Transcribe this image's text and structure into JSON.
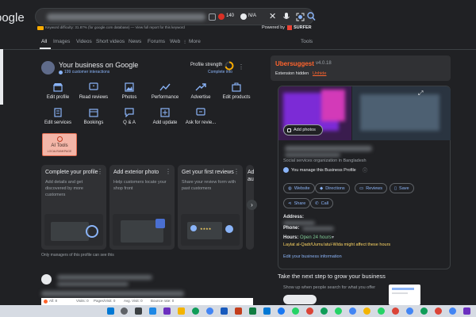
{
  "header": {
    "logo": "oogle",
    "search_right": {
      "score": "140",
      "na": "N/A"
    },
    "keyword_line": "Keyword difficulty: 31.87% (for google.com database) — View full report for this keyword",
    "powered_by": "Powered by",
    "surfer": "SURFER"
  },
  "tabs": [
    "All",
    "Images",
    "Videos",
    "Short videos",
    "News",
    "Forums",
    "Web",
    "More",
    "Tools"
  ],
  "business": {
    "title": "Your business on Google",
    "interactions": "199 customer interactions",
    "strength_label": "Profile strength",
    "complete_info": "Complete info",
    "actions_row1": [
      "Edit profile",
      "Read reviews",
      "Photos",
      "Performance",
      "Advertise",
      "Edit products"
    ],
    "actions_row2": [
      "Edit services",
      "Bookings",
      "Q & A",
      "Add update",
      "Ask for revie..."
    ],
    "ai_tools": "AI Tools",
    "ai_tools_sub": "LOCALRANKPAGE",
    "tasks": [
      {
        "title": "Complete your profile",
        "desc": "Add details and get discovered by more customers"
      },
      {
        "title": "Add exterior photo",
        "desc": "Help customers locate your shop front"
      },
      {
        "title": "Get your first reviews",
        "desc": "Share your review form with past customers"
      },
      {
        "title": "Ad",
        "desc": "au"
      }
    ],
    "footer": "Only managers of this profile can see this"
  },
  "ubersuggest": {
    "title": "Ubersuggest",
    "version": "v4.0.18",
    "hidden": "Extension hidden",
    "unhide": "Unhide"
  },
  "knowledge_panel": {
    "add_photos": "Add photos",
    "category": "Social services organization in Bangladesh",
    "manage": "You manage this Business Profile",
    "buttons": [
      "Website",
      "Directions",
      "Reviews",
      "Save",
      "Share",
      "Call"
    ],
    "address_label": "Address:",
    "phone_label": "Phone:",
    "hours_label": "Hours:",
    "hours_value": "Open 24 hours",
    "hours_warning": "Laylat al-Qadr/Uumu'atul-Wida might affect these hours",
    "edit_info": "Edit your business information"
  },
  "grow": {
    "title": "Take the next step to grow your business",
    "desc": "Show up when people search for what you offer"
  },
  "bottom_bar": {
    "all": "All: 8",
    "visits": "Visits: 0",
    "pages": "Pages/Visit: 0",
    "avg": "Avg. Visit: 0",
    "bounce": "Bounce rate: 0"
  },
  "colors": {
    "accent": "#8ab4f8",
    "orange": "#f9ab00",
    "uber": "#ff642d",
    "green": "#81c995",
    "warn": "#fdd663"
  }
}
